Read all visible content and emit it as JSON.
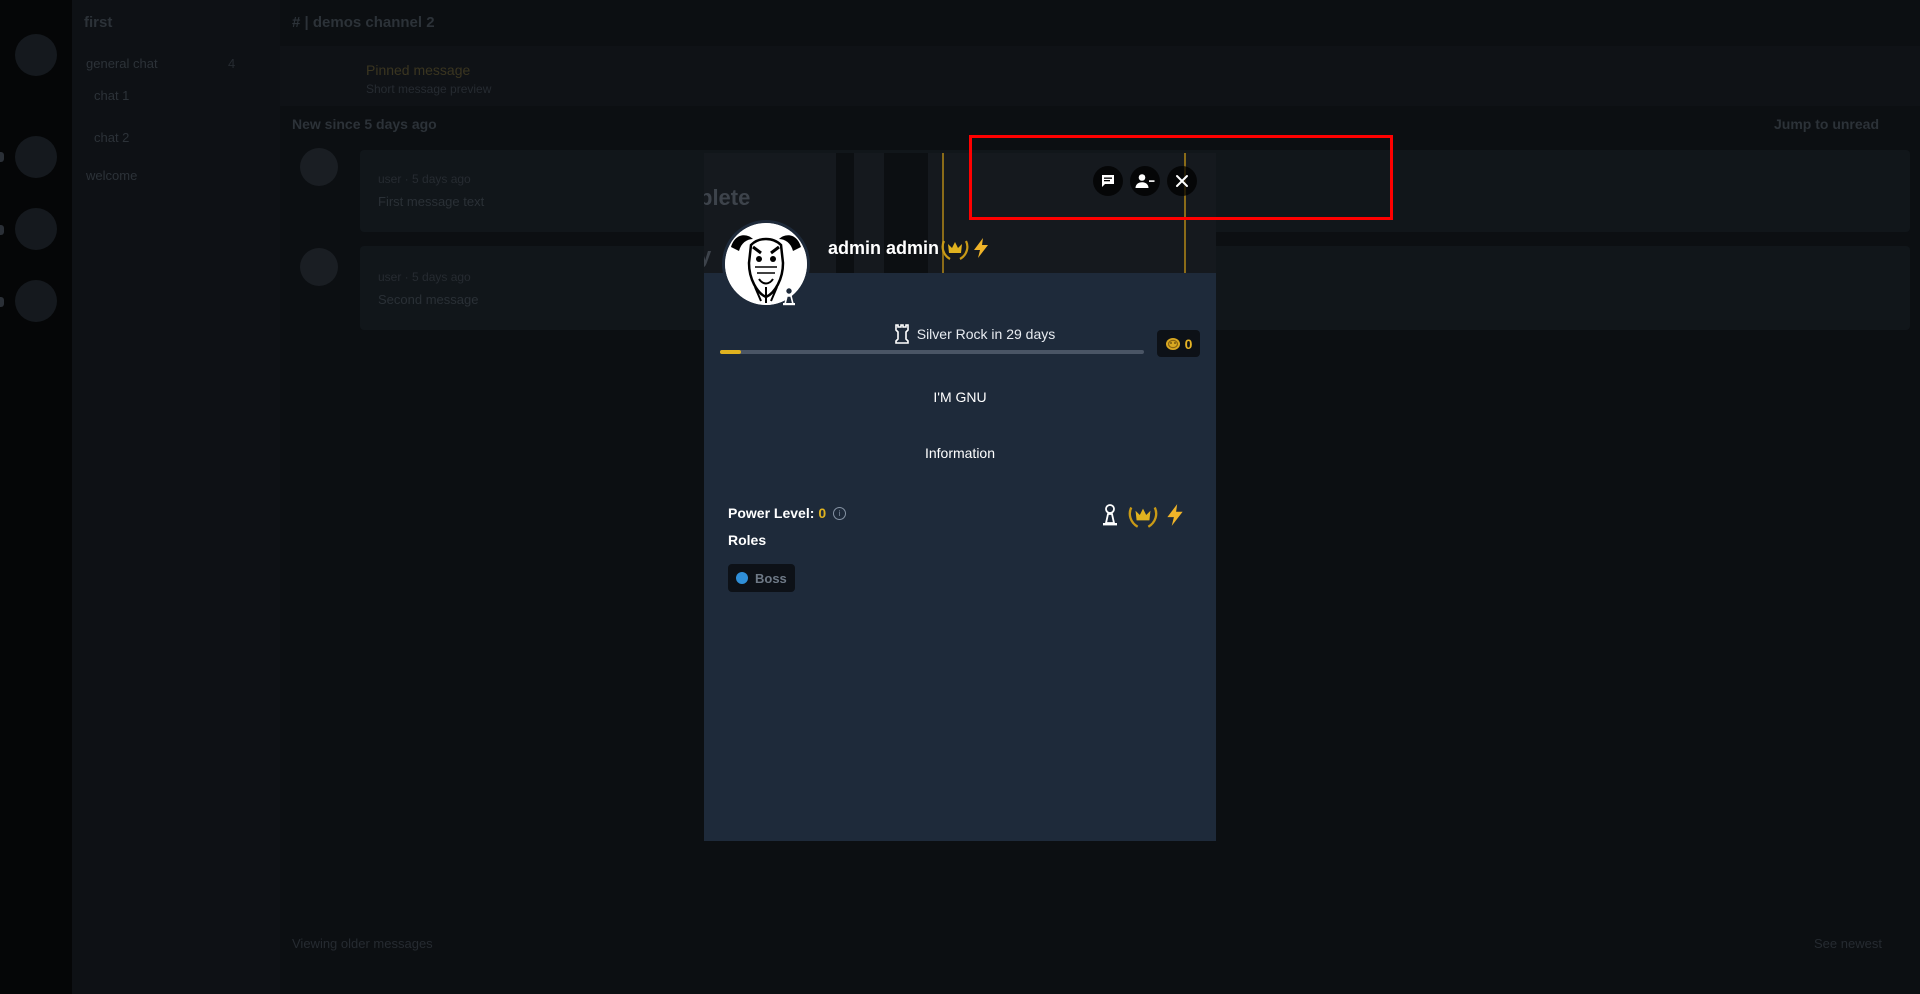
{
  "background": {
    "server_name": "first",
    "channels": [
      "general chat",
      "chat 1",
      "chat 2",
      "welcome"
    ],
    "channel_header": "# | demos channel 2",
    "pinned_title": "Pinned message",
    "pinned_sub": "Short message preview",
    "new_since": "New since 5 days ago",
    "jump_to_unread": "Jump to unread",
    "messages": [
      {
        "author": "user · 5 days ago",
        "text": "First message text"
      },
      {
        "author": "user · 5 days ago",
        "text": "Second message"
      }
    ],
    "bottom_left": "Viewing older messages",
    "bottom_right": "See newest"
  },
  "modal": {
    "display_name": "admin admin",
    "rank_text": "Silver Rock in 29 days",
    "rank_progress": 0.05,
    "coins": "0",
    "bio": "I'M GNU",
    "info_button": "Information",
    "power_level_label": "Power Level:",
    "power_level_value": "0",
    "roles_title": "Roles",
    "roles": [
      {
        "name": "Boss",
        "color": "#2f8fd8"
      }
    ],
    "banner_text_1": "plete",
    "banner_text_2": "y"
  },
  "colors": {
    "modal_bg": "#1e2a3a",
    "accent_gold": "#e0b21f",
    "highlight": "#ff0000"
  },
  "icons": {
    "message": "message-icon",
    "remove_friend": "remove-friend-icon",
    "close": "close-icon",
    "rank": "rook-icon",
    "coin": "coin-icon",
    "crown": "crown-laurel-icon",
    "lightning": "lightning-icon",
    "chess": "pawn-icon"
  }
}
